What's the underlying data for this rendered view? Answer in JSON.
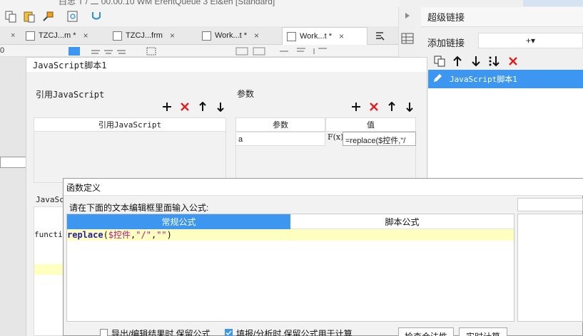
{
  "window": {
    "title": "白忠 T / 二 00.00.10 WM ErentQueue 3 El&eh [Standard]"
  },
  "editor_tabs": [
    {
      "label": "TZCJ...m *",
      "close": "×"
    },
    {
      "label": "TZCJ...frm",
      "close": "×"
    },
    {
      "label": "Work...t *",
      "close": "×"
    },
    {
      "label": "Work...t *",
      "close": "×"
    }
  ],
  "format_toolbar": {
    "zoom": "0"
  },
  "right_panel": {
    "title": "超级链接",
    "add_label": "添加链接",
    "add_button": "+▾",
    "items": [
      {
        "label": "JavaScript脚本1"
      }
    ]
  },
  "js_dialog": {
    "title": "JavaScript脚本1",
    "ref_section": {
      "label": "引用JavaScript",
      "column_header": "引用JavaScript"
    },
    "param_section": {
      "label": "参数",
      "columns": [
        "参数",
        "值"
      ],
      "rows": [
        {
          "name": "a",
          "formula_icon": "F(x)",
          "value": "=replace($控件,\"/"
        }
      ]
    },
    "script_label": "JavaSc",
    "script_code": "functio"
  },
  "function_dialog": {
    "title": "函数定义",
    "prompt": "请在下面的文本编辑框里面输入公式:",
    "tabs": [
      {
        "label": "常规公式",
        "active": true
      },
      {
        "label": "脚本公式",
        "active": false
      }
    ],
    "formula": {
      "fn": "replace",
      "open": "(",
      "arg1": "$控件",
      "comma1": ",",
      "arg2": "\"/\"",
      "comma2": ",",
      "arg3": "\"\"",
      "close": ")"
    },
    "options": [
      {
        "label": "导出/编辑结果时,保留公式",
        "checked": false
      },
      {
        "label": "填报/分析时,保留公式用于计算",
        "checked": true
      }
    ],
    "buttons": {
      "check": "检查合法性",
      "realtime": "实时计算"
    }
  },
  "colors": {
    "accent": "#3d97f0",
    "delete_red": "#e02020",
    "code_line": "#ffffc0"
  }
}
